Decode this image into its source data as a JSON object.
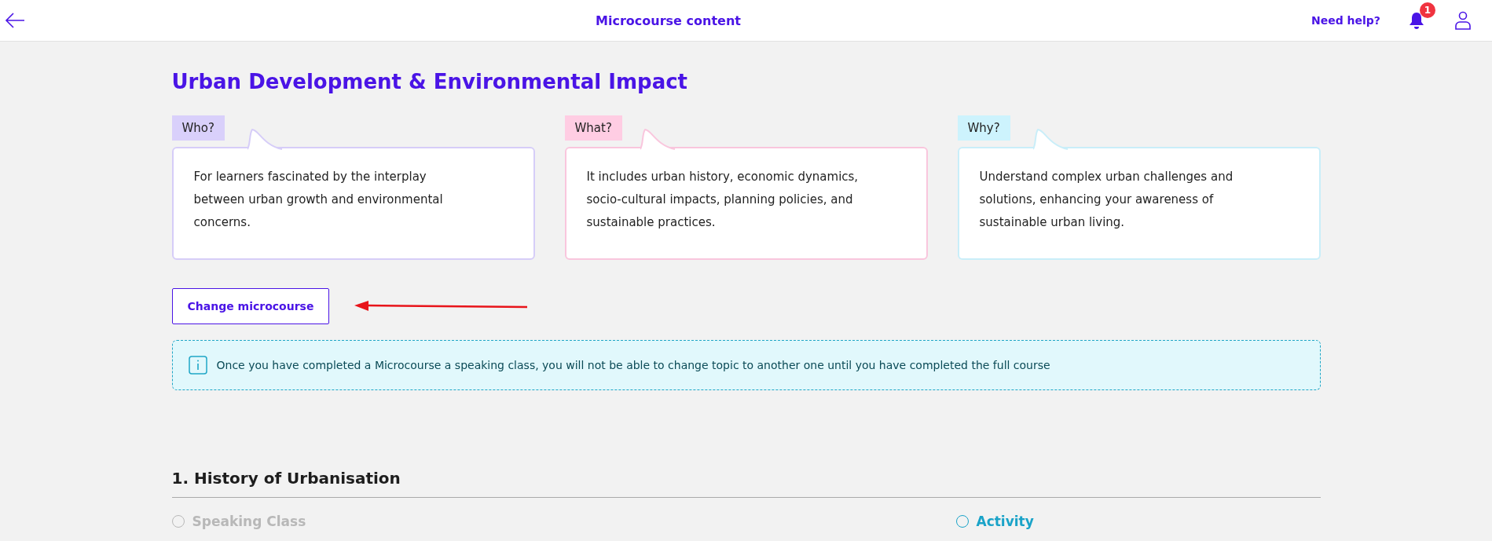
{
  "header": {
    "title": "Microcourse content",
    "help": "Need help?",
    "notification_count": "1"
  },
  "course": {
    "title": "Urban Development & Environmental Impact",
    "cards": [
      {
        "kind": "who",
        "tag": "Who?",
        "text": "For learners fascinated by the interplay between urban growth and environmental concerns."
      },
      {
        "kind": "what",
        "tag": "What?",
        "text": "It includes urban history, economic dynamics, socio-cultural impacts, planning policies, and sustainable practices."
      },
      {
        "kind": "why",
        "tag": "Why?",
        "text": "Understand complex urban challenges and solutions, enhancing your awareness of sustainable urban living."
      }
    ],
    "change_button": "Change microcourse",
    "info": "Once you have completed a Microcourse a speaking class, you will not be able to change topic to another one until you have completed the full course"
  },
  "sections": [
    {
      "title": "1. History of Urbanisation",
      "items": [
        {
          "label": "Speaking Class",
          "disabled": true
        },
        {
          "label": "Activity",
          "disabled": false
        }
      ]
    }
  ]
}
